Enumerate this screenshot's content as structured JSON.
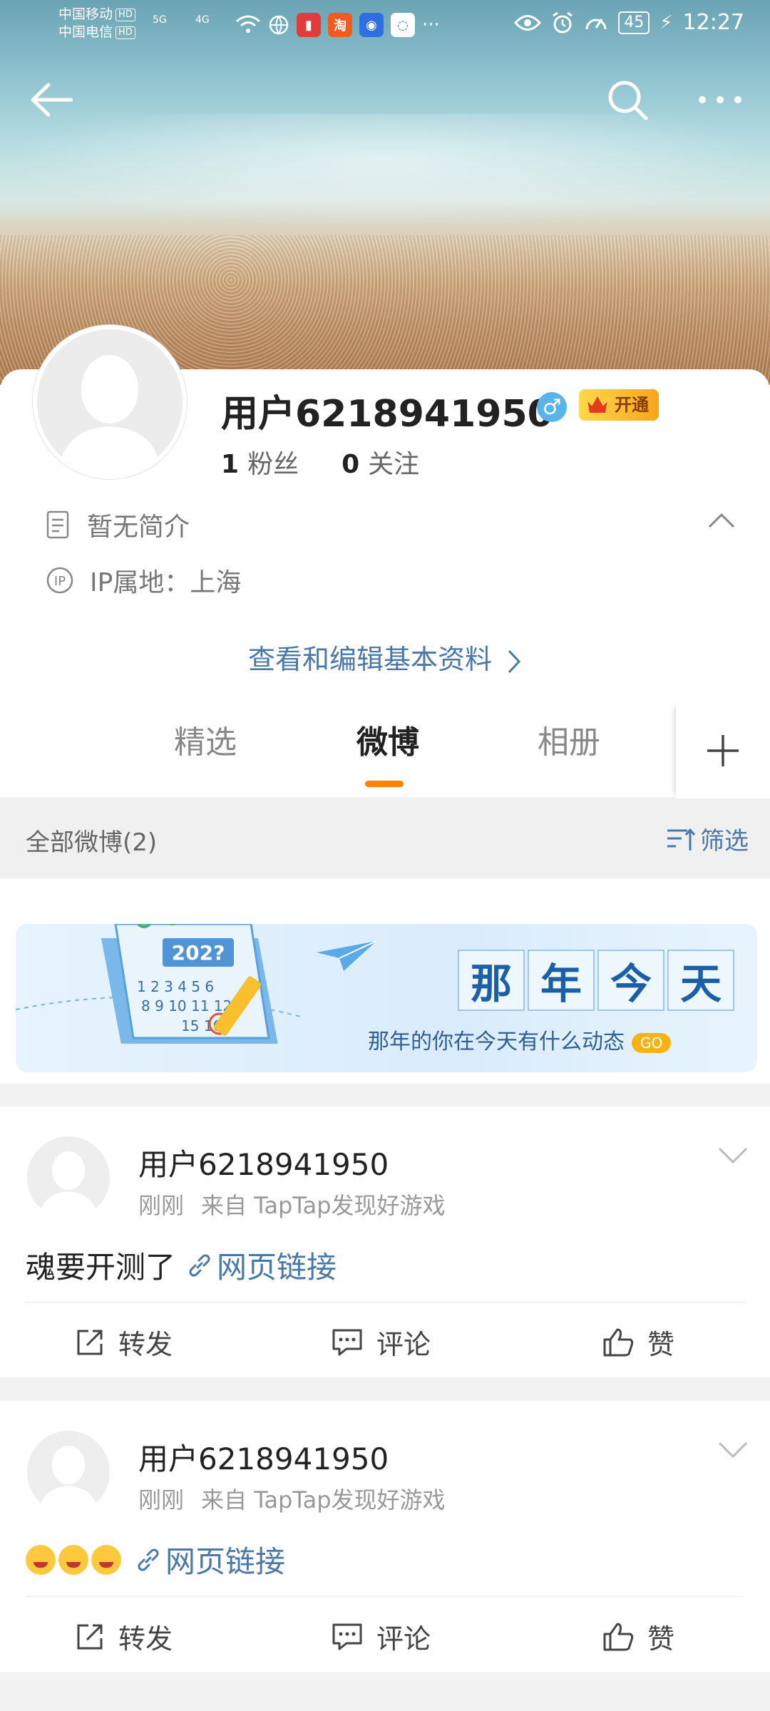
{
  "status_bar": {
    "carrier1": "中国移动",
    "carrier2": "中国电信",
    "hd": "HD",
    "net1": "5G",
    "net2": "4G",
    "battery": "45",
    "time": "12:27"
  },
  "profile": {
    "username": "用户6218941950",
    "vip_label": "开通",
    "fans_count": "1",
    "fans_label": "粉丝",
    "follow_count": "0",
    "follow_label": "关注",
    "bio": "暂无简介",
    "ip_location": "IP属地：上海",
    "edit_link": "查看和编辑基本资料"
  },
  "tabs": [
    {
      "label": "精选",
      "active": false
    },
    {
      "label": "微博",
      "active": true
    },
    {
      "label": "相册",
      "active": false
    }
  ],
  "filter": {
    "title": "全部微博(2)",
    "button": "筛选"
  },
  "banner": {
    "chars": [
      "那",
      "年",
      "今",
      "天"
    ],
    "subtitle": "那年的你在今天有什么动态",
    "go": "GO",
    "calendar_year": "202?"
  },
  "posts": [
    {
      "author": "用户6218941950",
      "time": "刚刚",
      "source": "来自 TapTap发现好游戏",
      "text": "魂要开测了",
      "link": "网页链接",
      "repost": "转发",
      "comment": "评论",
      "like": "赞"
    },
    {
      "author": "用户6218941950",
      "time": "刚刚",
      "source": "来自 TapTap发现好游戏",
      "text": "",
      "link": "网页链接",
      "repost": "转发",
      "comment": "评论",
      "like": "赞"
    }
  ],
  "colors": {
    "accent": "#ff8200",
    "link": "#4a78a8"
  }
}
